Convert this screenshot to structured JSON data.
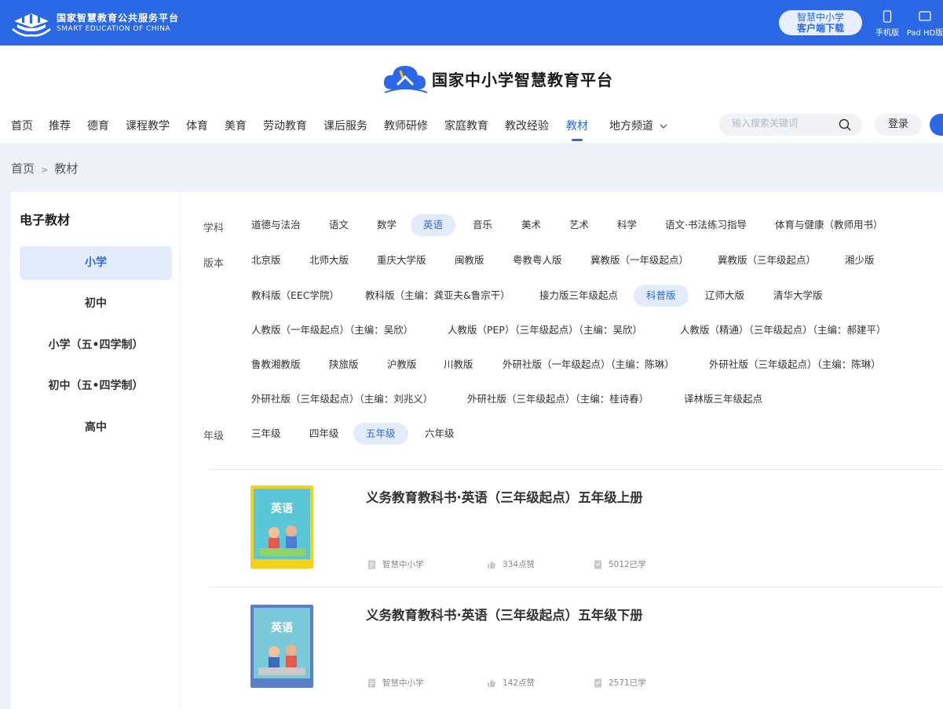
{
  "topbar": {
    "brand_cn": "国家智慧教育公共服务平台",
    "brand_en": "SMART EDUCATION OF CHINA",
    "download_line1": "智慧中小学",
    "download_line2": "客户端下载",
    "phone_label": "手机版",
    "pad_label": "Pad HD版"
  },
  "header": {
    "site_title": "国家中小学智慧教育平台",
    "nav": [
      "首页",
      "推荐",
      "德育",
      "课程教学",
      "体育",
      "美育",
      "劳动教育",
      "课后服务",
      "教师研修",
      "家庭教育",
      "教改经验",
      "教材",
      "地方频道"
    ],
    "active_nav": "教材",
    "search_placeholder": "输入搜索关键词",
    "login_label": "登录"
  },
  "breadcrumb": {
    "home": "首页",
    "separator": ">",
    "current": "教材"
  },
  "left": {
    "title": "电子教材",
    "items": [
      "小学",
      "初中",
      "小学（五•四学制）",
      "初中（五•四学制）",
      "高中"
    ],
    "active": "小学"
  },
  "filters": {
    "subject": {
      "label": "学科",
      "options": [
        "道德与法治",
        "语文",
        "数学",
        "英语",
        "音乐",
        "美术",
        "艺术",
        "科学",
        "语文·书法练习指导",
        "体育与健康（教师用书）"
      ],
      "active": "英语"
    },
    "edition": {
      "label": "版本",
      "rows": [
        [
          "北京版",
          "北师大版",
          "重庆大学版",
          "闽教版",
          "粤教粤人版",
          "冀教版（一年级起点）",
          "冀教版（三年级起点）",
          "湘少版"
        ],
        [
          "教科版（EEC学院）",
          "教科版（主编：龚亚夫&鲁宗干）",
          "接力版三年级起点",
          "科普版",
          "辽师大版",
          "清华大学版"
        ],
        [
          "人教版（一年级起点）（主编：吴欣）",
          "人教版（PEP）（三年级起点）（主编：吴欣）",
          "人教版（精通）（三年级起点）（主编：郝建平）"
        ],
        [
          "鲁教湘教版",
          "陕旅版",
          "沪教版",
          "川教版",
          "外研社版（一年级起点）（主编：陈琳）",
          "外研社版（三年级起点）（主编：陈琳）"
        ],
        [
          "外研社版（三年级起点）（主编：刘兆义）",
          "外研社版（三年级起点）（主编：桂诗春）",
          "译林版三年级起点"
        ]
      ],
      "active": "科普版"
    },
    "grade": {
      "label": "年级",
      "options": [
        "三年级",
        "四年级",
        "五年级",
        "六年级"
      ],
      "active": "五年级"
    }
  },
  "books": [
    {
      "title": "义务教育教科书·英语（三年级起点）五年级上册",
      "source": "智慧中小学",
      "likes": "334点赞",
      "learners": "5012已学",
      "cover_color": "#f5d21a",
      "cover_label": "英语"
    },
    {
      "title": "义务教育教科书·英语（三年级起点）五年级下册",
      "source": "智慧中小学",
      "likes": "142点赞",
      "learners": "2571已学",
      "cover_color": "#5b7fc7",
      "cover_label": "英语"
    }
  ],
  "icons": {
    "brand": "book-hands-logo",
    "site": "cloud-book-logo",
    "search": "search-icon",
    "phone": "phone-icon",
    "pad": "tablet-icon",
    "chevron": "chevron-down-icon",
    "source": "document-icon",
    "like": "thumbs-up-icon",
    "learner": "learner-icon"
  },
  "colors": {
    "primary": "#2b68e6",
    "active_bg": "#e3ecfb",
    "page_bg": "#eef2f8"
  }
}
